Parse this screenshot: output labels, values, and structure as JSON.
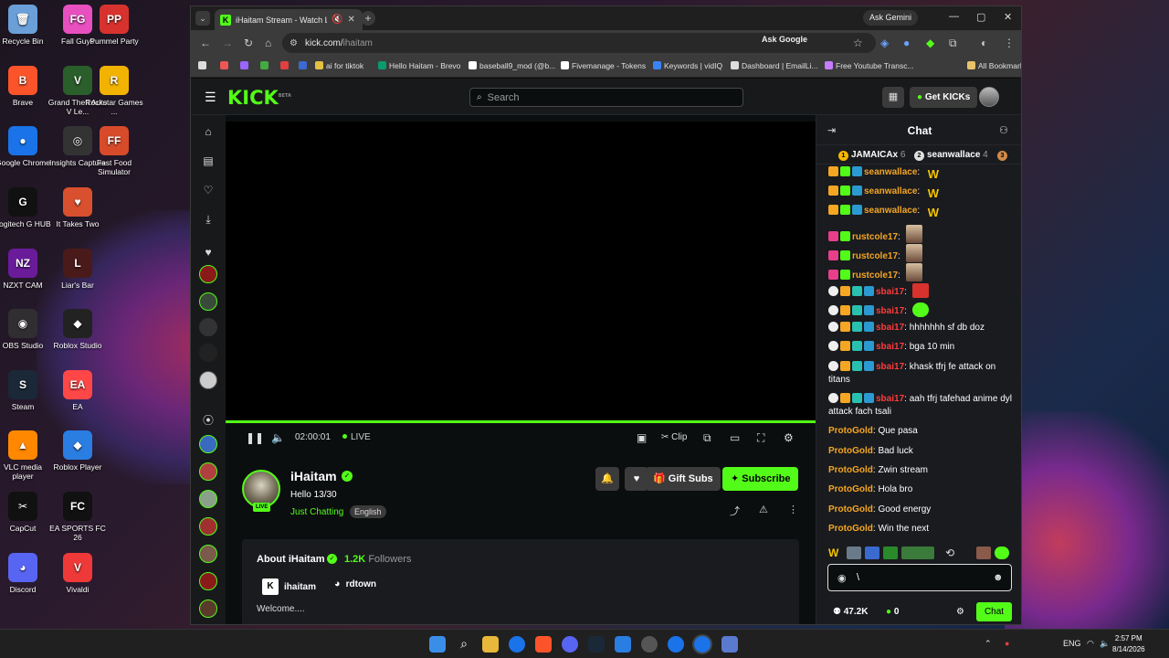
{
  "desktop": {
    "icons": [
      {
        "label": "Recycle Bin",
        "color": "#6a9fd8",
        "glyph": "🗑"
      },
      {
        "label": "Fall Guys",
        "color": "#e84fbf",
        "glyph": "FG"
      },
      {
        "label": "Pummel Party",
        "color": "#d8322e",
        "glyph": "PP"
      },
      {
        "label": "Brave",
        "color": "#fb542b",
        "glyph": "B"
      },
      {
        "label": "Grand Theft Auto V Le...",
        "color": "#2a5e2a",
        "glyph": "V"
      },
      {
        "label": "Rockstar Games ...",
        "color": "#f2b300",
        "glyph": "R"
      },
      {
        "label": "Google Chrome",
        "color": "#1a73e8",
        "glyph": "●"
      },
      {
        "label": "Insights Capture",
        "color": "#333333",
        "glyph": "◎"
      },
      {
        "label": "Fast Food Simulator",
        "color": "#d84b2a",
        "glyph": "FF"
      },
      {
        "label": "Logitech G HUB",
        "color": "#111111",
        "glyph": "G"
      },
      {
        "label": "It Takes Two",
        "color": "#d8502e",
        "glyph": "♥"
      },
      {
        "label": "NZXT CAM",
        "color": "#6a1b9a",
        "glyph": "NZ"
      },
      {
        "label": "Liar's Bar",
        "color": "#4a1a1a",
        "glyph": "L"
      },
      {
        "label": "OBS Studio",
        "color": "#302e31",
        "glyph": "◉"
      },
      {
        "label": "Roblox Studio",
        "color": "#222222",
        "glyph": "◆"
      },
      {
        "label": "Steam",
        "color": "#1b2838",
        "glyph": "S"
      },
      {
        "label": "EA",
        "color": "#ff4747",
        "glyph": "EA"
      },
      {
        "label": "VLC media player",
        "color": "#ff8800",
        "glyph": "▲"
      },
      {
        "label": "Roblox Player",
        "color": "#2a7de1",
        "glyph": "◆"
      },
      {
        "label": "CapCut",
        "color": "#111111",
        "glyph": "✂"
      },
      {
        "label": "EA SPORTS FC 26",
        "color": "#111111",
        "glyph": "FC"
      },
      {
        "label": "Discord",
        "color": "#5865f2",
        "glyph": "◕"
      },
      {
        "label": "Vivaldi",
        "color": "#ef3939",
        "glyph": "V"
      }
    ]
  },
  "browser": {
    "tab_title": "iHaitam Stream - Watch Live",
    "ask_gemini": "Ask Gemini",
    "url_host": "kick.com/",
    "url_path": "ihaitam",
    "ask_google": "Ask Google",
    "bookmarks": [
      {
        "label": "ai for tiktok",
        "color": "#e2c044"
      },
      {
        "label": "Hello Haitam - Brevo",
        "color": "#0b996e"
      },
      {
        "label": "baseball9_mod (@b...",
        "color": "#ffffff"
      },
      {
        "label": "Fivemanage - Tokens",
        "color": "#ffffff"
      },
      {
        "label": "Keywords | vidIQ",
        "color": "#3b82f6"
      },
      {
        "label": "Dashboard | EmailLi...",
        "color": "#dddddd"
      },
      {
        "label": "Free Youtube Transc...",
        "color": "#c77dff"
      }
    ],
    "all_bookmarks": "All Bookmarks"
  },
  "kick": {
    "logo": "KICK",
    "logo_beta": "BETA",
    "search_placeholder": "Search",
    "get_kicks": "Get KICKs",
    "player": {
      "timecode": "02:00:01",
      "live": "LIVE",
      "clip": "Clip"
    },
    "channel": {
      "name": "iHaitam",
      "title": "Hello 13/30",
      "category": "Just Chatting",
      "language": "English",
      "live_badge": "LIVE",
      "gift_subs": "Gift Subs",
      "subscribe": "Subscribe"
    },
    "about": {
      "title": "About iHaitam",
      "followers_count": "1.2K",
      "followers_label": "Followers",
      "kick_handle": "ihaitam",
      "discord_handle": "rdtown",
      "bio": "Welcome...."
    },
    "chat": {
      "title": "Chat",
      "leaderboard": [
        {
          "rank": "1",
          "name": "JAMAICAx",
          "count": "6",
          "color": "#f5b800"
        },
        {
          "rank": "2",
          "name": "seanwallace",
          "count": "4",
          "color": "#e0e0e0"
        },
        {
          "rank": "3",
          "name": "",
          "count": "",
          "color": "#d08a4a"
        }
      ],
      "messages": [
        {
          "user": "seanwallace",
          "color": "#f5a623",
          "text": "",
          "emote": "W"
        },
        {
          "user": "seanwallace",
          "color": "#f5a623",
          "text": "",
          "emote": "W"
        },
        {
          "user": "seanwallace",
          "color": "#f5a623",
          "text": "",
          "emote": "W"
        },
        {
          "user": "rustcole17",
          "color": "#f5a623",
          "text": "",
          "emote": "img"
        },
        {
          "user": "rustcole17",
          "color": "#f5a623",
          "text": "",
          "emote": "img"
        },
        {
          "user": "rustcole17",
          "color": "#f5a623",
          "text": "",
          "emote": "img"
        },
        {
          "user": "sbai17",
          "color": "#ff3b3b",
          "text": "",
          "emote": "red"
        },
        {
          "user": "sbai17",
          "color": "#ff3b3b",
          "text": "",
          "emote": "green"
        },
        {
          "user": "sbai17",
          "color": "#ff3b3b",
          "text": "hhhhhhh sf db doz",
          "emote": ""
        },
        {
          "user": "sbai17",
          "color": "#ff3b3b",
          "text": "bga 10 min",
          "emote": ""
        },
        {
          "user": "sbai17",
          "color": "#ff3b3b",
          "text": "khask tfrj fe attack on titans",
          "emote": ""
        },
        {
          "user": "sbai17",
          "color": "#ff3b3b",
          "text": "aah tfrj tafehad anime dyl attack fach tsali",
          "emote": ""
        },
        {
          "user": "ProtoGold",
          "color": "#f5a623",
          "text": "Que pasa",
          "emote": ""
        },
        {
          "user": "ProtoGold",
          "color": "#f5a623",
          "text": "Bad luck",
          "emote": ""
        },
        {
          "user": "ProtoGold",
          "color": "#f5a623",
          "text": "Zwin stream",
          "emote": ""
        },
        {
          "user": "ProtoGold",
          "color": "#f5a623",
          "text": "Hola bro",
          "emote": ""
        },
        {
          "user": "ProtoGold",
          "color": "#f5a623",
          "text": "Good energy",
          "emote": ""
        },
        {
          "user": "ProtoGold",
          "color": "#f5a623",
          "text": "Win the next",
          "emote": ""
        }
      ],
      "input_value": "\\",
      "viewers": "47.2K",
      "kicks": "0",
      "send_label": "Chat"
    }
  },
  "taskbar": {
    "lang": "ENG",
    "time": "2:57 PM",
    "date": "8/14/2026"
  },
  "colors": {
    "accent": "#53fc18",
    "panel": "#191b1f",
    "bg": "#0b0e0f"
  }
}
